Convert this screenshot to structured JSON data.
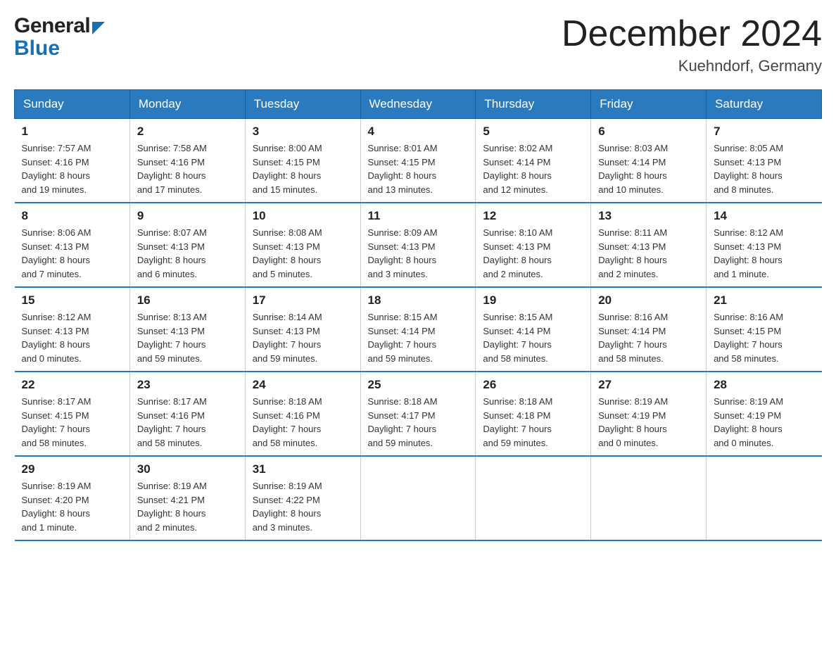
{
  "header": {
    "title": "December 2024",
    "location": "Kuehndorf, Germany"
  },
  "logo": {
    "general": "General",
    "blue": "Blue"
  },
  "days_of_week": [
    "Sunday",
    "Monday",
    "Tuesday",
    "Wednesday",
    "Thursday",
    "Friday",
    "Saturday"
  ],
  "weeks": [
    [
      {
        "day": "1",
        "sunrise": "7:57 AM",
        "sunset": "4:16 PM",
        "daylight": "8 hours and 19 minutes."
      },
      {
        "day": "2",
        "sunrise": "7:58 AM",
        "sunset": "4:16 PM",
        "daylight": "8 hours and 17 minutes."
      },
      {
        "day": "3",
        "sunrise": "8:00 AM",
        "sunset": "4:15 PM",
        "daylight": "8 hours and 15 minutes."
      },
      {
        "day": "4",
        "sunrise": "8:01 AM",
        "sunset": "4:15 PM",
        "daylight": "8 hours and 13 minutes."
      },
      {
        "day": "5",
        "sunrise": "8:02 AM",
        "sunset": "4:14 PM",
        "daylight": "8 hours and 12 minutes."
      },
      {
        "day": "6",
        "sunrise": "8:03 AM",
        "sunset": "4:14 PM",
        "daylight": "8 hours and 10 minutes."
      },
      {
        "day": "7",
        "sunrise": "8:05 AM",
        "sunset": "4:13 PM",
        "daylight": "8 hours and 8 minutes."
      }
    ],
    [
      {
        "day": "8",
        "sunrise": "8:06 AM",
        "sunset": "4:13 PM",
        "daylight": "8 hours and 7 minutes."
      },
      {
        "day": "9",
        "sunrise": "8:07 AM",
        "sunset": "4:13 PM",
        "daylight": "8 hours and 6 minutes."
      },
      {
        "day": "10",
        "sunrise": "8:08 AM",
        "sunset": "4:13 PM",
        "daylight": "8 hours and 5 minutes."
      },
      {
        "day": "11",
        "sunrise": "8:09 AM",
        "sunset": "4:13 PM",
        "daylight": "8 hours and 3 minutes."
      },
      {
        "day": "12",
        "sunrise": "8:10 AM",
        "sunset": "4:13 PM",
        "daylight": "8 hours and 2 minutes."
      },
      {
        "day": "13",
        "sunrise": "8:11 AM",
        "sunset": "4:13 PM",
        "daylight": "8 hours and 2 minutes."
      },
      {
        "day": "14",
        "sunrise": "8:12 AM",
        "sunset": "4:13 PM",
        "daylight": "8 hours and 1 minute."
      }
    ],
    [
      {
        "day": "15",
        "sunrise": "8:12 AM",
        "sunset": "4:13 PM",
        "daylight": "8 hours and 0 minutes."
      },
      {
        "day": "16",
        "sunrise": "8:13 AM",
        "sunset": "4:13 PM",
        "daylight": "7 hours and 59 minutes."
      },
      {
        "day": "17",
        "sunrise": "8:14 AM",
        "sunset": "4:13 PM",
        "daylight": "7 hours and 59 minutes."
      },
      {
        "day": "18",
        "sunrise": "8:15 AM",
        "sunset": "4:14 PM",
        "daylight": "7 hours and 59 minutes."
      },
      {
        "day": "19",
        "sunrise": "8:15 AM",
        "sunset": "4:14 PM",
        "daylight": "7 hours and 58 minutes."
      },
      {
        "day": "20",
        "sunrise": "8:16 AM",
        "sunset": "4:14 PM",
        "daylight": "7 hours and 58 minutes."
      },
      {
        "day": "21",
        "sunrise": "8:16 AM",
        "sunset": "4:15 PM",
        "daylight": "7 hours and 58 minutes."
      }
    ],
    [
      {
        "day": "22",
        "sunrise": "8:17 AM",
        "sunset": "4:15 PM",
        "daylight": "7 hours and 58 minutes."
      },
      {
        "day": "23",
        "sunrise": "8:17 AM",
        "sunset": "4:16 PM",
        "daylight": "7 hours and 58 minutes."
      },
      {
        "day": "24",
        "sunrise": "8:18 AM",
        "sunset": "4:16 PM",
        "daylight": "7 hours and 58 minutes."
      },
      {
        "day": "25",
        "sunrise": "8:18 AM",
        "sunset": "4:17 PM",
        "daylight": "7 hours and 59 minutes."
      },
      {
        "day": "26",
        "sunrise": "8:18 AM",
        "sunset": "4:18 PM",
        "daylight": "7 hours and 59 minutes."
      },
      {
        "day": "27",
        "sunrise": "8:19 AM",
        "sunset": "4:19 PM",
        "daylight": "8 hours and 0 minutes."
      },
      {
        "day": "28",
        "sunrise": "8:19 AM",
        "sunset": "4:19 PM",
        "daylight": "8 hours and 0 minutes."
      }
    ],
    [
      {
        "day": "29",
        "sunrise": "8:19 AM",
        "sunset": "4:20 PM",
        "daylight": "8 hours and 1 minute."
      },
      {
        "day": "30",
        "sunrise": "8:19 AM",
        "sunset": "4:21 PM",
        "daylight": "8 hours and 2 minutes."
      },
      {
        "day": "31",
        "sunrise": "8:19 AM",
        "sunset": "4:22 PM",
        "daylight": "8 hours and 3 minutes."
      },
      null,
      null,
      null,
      null
    ]
  ],
  "labels": {
    "sunrise": "Sunrise: ",
    "sunset": "Sunset: ",
    "daylight": "Daylight: "
  }
}
